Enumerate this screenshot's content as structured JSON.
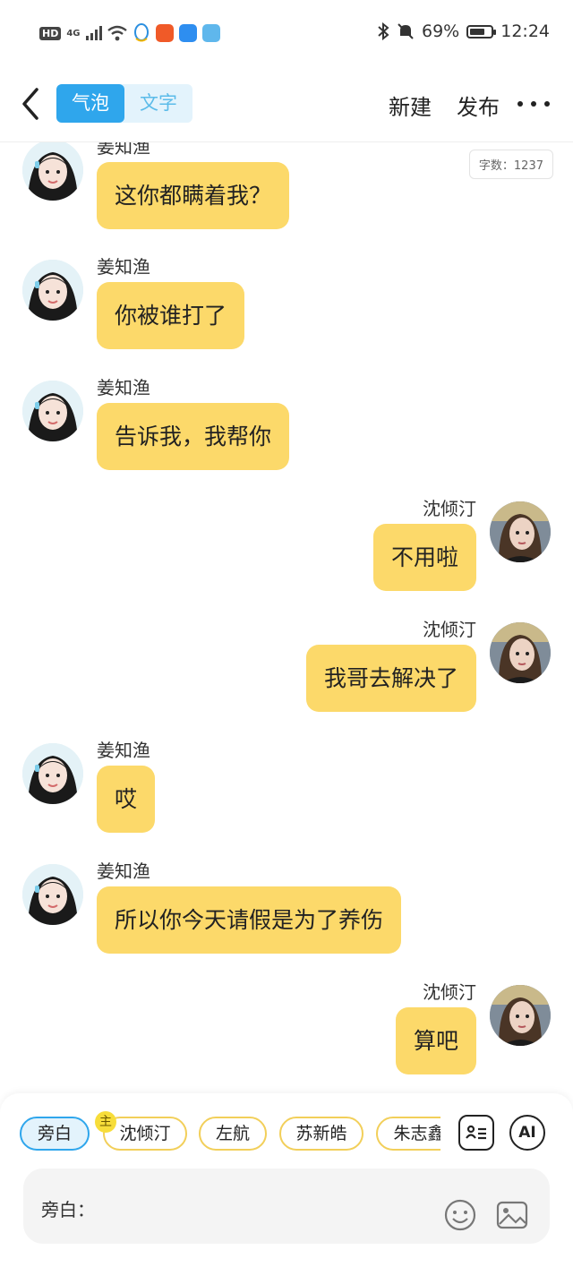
{
  "status_bar": {
    "hd": "HD",
    "network": "4G",
    "battery": "69%",
    "time": "12:24"
  },
  "header": {
    "tab_bubble": "气泡",
    "tab_text": "文字",
    "new_label": "新建",
    "publish_label": "发布"
  },
  "word_count": "字数：1237",
  "colors": {
    "bubble": "#fcd96a",
    "accent": "#2fa6ec",
    "chip_border": "#f2cf5a"
  },
  "messages": [
    {
      "side": "left",
      "name": "姜知渔",
      "text": "这你都瞒着我？"
    },
    {
      "side": "left",
      "name": "姜知渔",
      "text": "你被谁打了"
    },
    {
      "side": "left",
      "name": "姜知渔",
      "text": "告诉我，我帮你"
    },
    {
      "side": "right",
      "name": "沈倾汀",
      "text": "不用啦"
    },
    {
      "side": "right",
      "name": "沈倾汀",
      "text": "我哥去解决了"
    },
    {
      "side": "left",
      "name": "姜知渔",
      "text": "哎"
    },
    {
      "side": "left",
      "name": "姜知渔",
      "text": "所以你今天请假是为了养伤"
    },
    {
      "side": "right",
      "name": "沈倾汀",
      "text": "算吧"
    }
  ],
  "roles": [
    "旁白",
    "沈倾汀",
    "左航",
    "苏新皓",
    "朱志鑫"
  ],
  "role_badge": "主",
  "ai_label": "AI",
  "input": {
    "label": "旁白："
  }
}
